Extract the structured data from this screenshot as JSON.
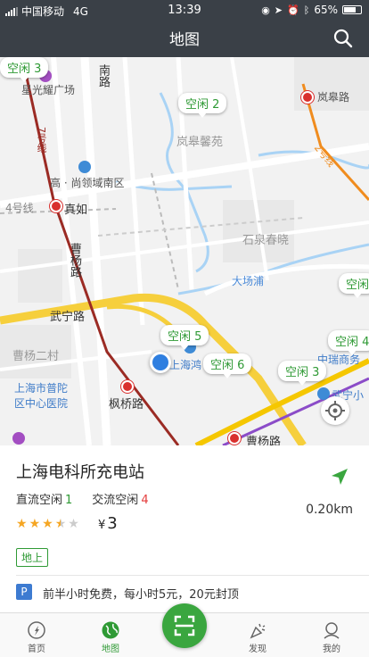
{
  "status_bar": {
    "carrier": "中国移动",
    "network": "4G",
    "time": "13:39",
    "battery": "65%"
  },
  "header": {
    "title": "地图",
    "search_icon": "search-icon"
  },
  "map": {
    "labels": {
      "xingguang": "星光耀广场",
      "nanlu": "南路",
      "langao": "岚皋馨苑",
      "langao_road": "岚皋路",
      "gaoshang": "高 · 尚领域南区",
      "line4": "4号线",
      "zhenru": "真如",
      "line7": "7号线",
      "line2": "2号线",
      "caoyang_road": "曹杨路",
      "shiquan": "石泉春晓",
      "dachang": "大场浦",
      "wuning": "武宁路",
      "caoyang2": "曹杨二村",
      "hospital": "上海市普陀区中心医院",
      "fengqiao": "枫桥路",
      "shanghaihong": "上海鸿",
      "zhongrui": "中瑞商务",
      "wuning_xiao": "武宁小",
      "caoyang_station": "曹杨路"
    },
    "markers": [
      "空闲 3",
      "空闲 2",
      "空闲 5",
      "空闲 6",
      "空闲 3",
      "空闲",
      "空闲 4"
    ],
    "colors": {
      "line_red": "#9b2b24",
      "line_orange": "#f08c1e",
      "line_yellow": "#f5c700",
      "line_purple": "#8b4cc8",
      "water": "#a9d3f5",
      "free_text": "#2f9a35"
    }
  },
  "station": {
    "name": "上海电科所充电站",
    "dc_label": "直流空闲",
    "dc_count": "1",
    "ac_label": "交流空闲",
    "ac_count": "4",
    "rating": 3.5,
    "currency": "¥",
    "price": "3",
    "distance": "0.20km",
    "tag": "地上",
    "parking_icon": "P",
    "parking_text": "前半小时免费，每小时5元，20元封顶"
  },
  "tabbar": {
    "home": "首页",
    "map": "地图",
    "discover": "发现",
    "mine": "我的"
  }
}
